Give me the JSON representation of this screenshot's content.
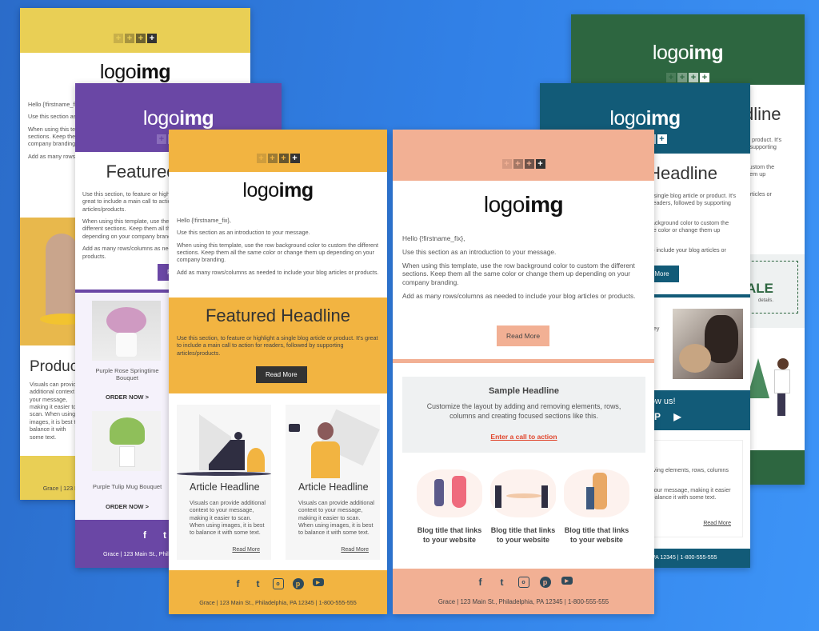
{
  "common": {
    "logo_light": "logo",
    "logo_bold": "img",
    "plus": "+",
    "greeting": "Hello {!firstname_fix},",
    "intro": "Use this section as an introduction to your message.",
    "custom": "When using this template, use the row background color to custom the different sections. Keep them all the same color or change them up depending on your company branding.",
    "rows": "Add as many rows/columns as needed to include your blog articles or products.",
    "featured_headline": "Featured Headline",
    "featured_text": "Use this section, to feature or highlight a single blog article or product. It's great to include a main call to action for readers, followed by supporting articles/products.",
    "read_more": "Read More",
    "article_headline": "Article Headline",
    "article_text": "Visuals can provide additional context to your message, making it easier to scan. When using images, it is best to balance it with some text.",
    "footer_address": "Grace | 123 Main St., Philadelphia, PA 12345 | 1-800-555-555",
    "social_icons": [
      "facebook-icon",
      "twitter-icon",
      "instagram-icon",
      "pinterest-icon",
      "youtube-icon"
    ]
  },
  "yellow_template": {
    "color": "#e9cf55",
    "product_headline": "Product",
    "product_text": "Visuals can provide additional context to your message, making it easier to scan. When using images, it is best to balance it with some text."
  },
  "purple_template": {
    "color": "#6a47a5",
    "products": [
      {
        "name": "Purple Rose Springtime Bouquet",
        "cta": "ORDER NOW >"
      },
      {
        "name": "Purple Tulip Mug Bouquet",
        "cta": "ORDER NOW >"
      }
    ]
  },
  "green_template": {
    "color": "#2d6640",
    "sale": "SALE",
    "sale_details": "details.",
    "footer_phone": "1-800-555-555"
  },
  "teal_template": {
    "color": "#125b78",
    "photo_text": "ey",
    "follow": "Follow us!",
    "article_intro": "Customize the layout by adding and removing elements, rows, columns and creating focused sections like this.",
    "footer_partial": "PA 12345 | 1-800-555-555"
  },
  "orange_template": {
    "color": "#f2b441"
  },
  "peach_template": {
    "color": "#f2b094",
    "sample_headline": "Sample Headline",
    "sample_text": "Customize the layout by adding and removing elements, rows, columns and creating focused sections like this.",
    "cta_link": "Enter a call to action",
    "blogs": [
      "Blog title that links to your website",
      "Blog title that links to your website",
      "Blog title that links to your website"
    ]
  }
}
